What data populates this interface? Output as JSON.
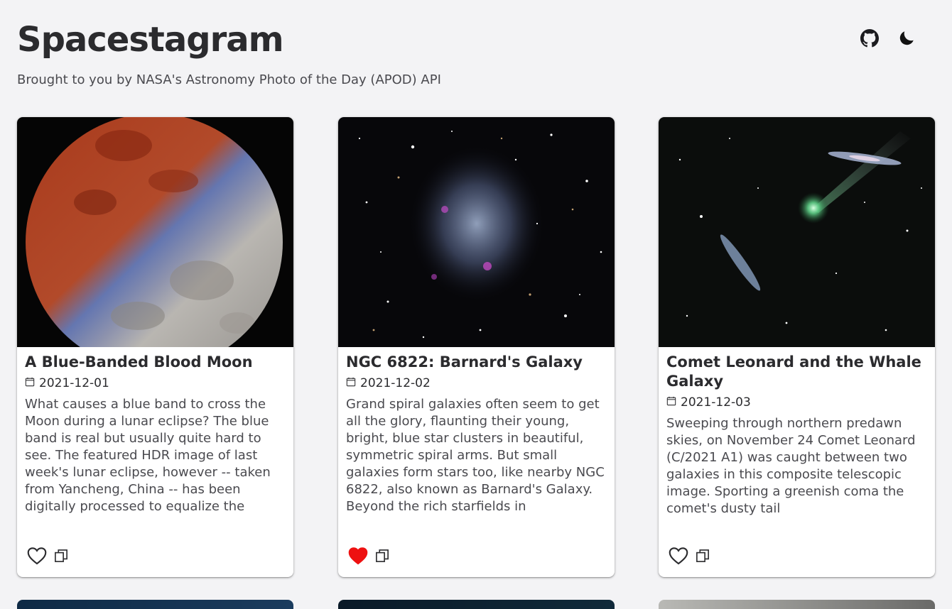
{
  "header": {
    "title": "Spacestagram",
    "subtitle": "Brought to you by NASA's Astronomy Photo of the Day (APOD) API",
    "actions": [
      {
        "icon": "github-icon"
      },
      {
        "icon": "moon-icon"
      }
    ]
  },
  "cards": [
    {
      "title": "A Blue-Banded Blood Moon",
      "date": "2021-12-01",
      "description": "What causes a blue band to cross the Moon during a lunar eclipse? The blue band is real but usually quite hard to see. The featured HDR image of last week's lunar eclipse, however -- taken from Yancheng, China -- has been digitally processed to equalize the",
      "liked": false
    },
    {
      "title": "NGC 6822: Barnard's Galaxy",
      "date": "2021-12-02",
      "description": "Grand spiral galaxies often seem to get all the glory, flaunting their young, bright, blue star clusters in beautiful, symmetric spiral arms. But small galaxies form stars too, like nearby NGC 6822, also known as Barnard's Galaxy. Beyond the rich starfields in",
      "liked": true
    },
    {
      "title": "Comet Leonard and the Whale Galaxy",
      "date": "2021-12-03",
      "description": "Sweeping through northern predawn skies, on November 24 Comet Leonard (C/2021 A1) was caught between two galaxies in this composite telescopic image. Sporting a greenish coma the comet's dusty tail",
      "liked": false
    }
  ],
  "colors": {
    "background": "#f3f3f5",
    "like_active": "#ee1111",
    "text": "#2b2b2e"
  }
}
